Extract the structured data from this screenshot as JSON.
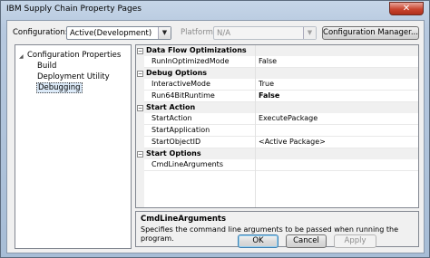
{
  "window": {
    "title": "IBM Supply Chain Property Pages",
    "close_glyph": "✕"
  },
  "toolbar": {
    "configuration_label": "Configuration:",
    "configuration_value": "Active(Development)",
    "platform_label": "Platform:",
    "platform_value": "N/A",
    "configuration_manager_label": "Configuration Manager..."
  },
  "tree": {
    "root": "Configuration Properties",
    "items": [
      {
        "label": "Build"
      },
      {
        "label": "Deployment Utility"
      },
      {
        "label": "Debugging"
      }
    ],
    "selected": "Debugging"
  },
  "grid": {
    "categories": [
      {
        "name": "Data Flow Optimizations",
        "rows": [
          {
            "name": "RunInOptimizedMode",
            "value": "False"
          }
        ]
      },
      {
        "name": "Debug Options",
        "rows": [
          {
            "name": "InteractiveMode",
            "value": "True"
          },
          {
            "name": "Run64BitRuntime",
            "value": "False"
          }
        ]
      },
      {
        "name": "Start Action",
        "rows": [
          {
            "name": "StartAction",
            "value": "ExecutePackage"
          },
          {
            "name": "StartApplication",
            "value": ""
          },
          {
            "name": "StartObjectID",
            "value": "<Active Package>"
          }
        ]
      },
      {
        "name": "Start Options",
        "rows": [
          {
            "name": "CmdLineArguments",
            "value": ""
          }
        ]
      }
    ],
    "expanded_glyph": "−"
  },
  "description": {
    "title": "CmdLineArguments",
    "text": "Specifies the command line arguments to be passed when running the program."
  },
  "buttons": {
    "ok": "OK",
    "cancel": "Cancel",
    "apply": "Apply"
  },
  "icons": {
    "dropdown": "▼",
    "tree_expander": "◢"
  }
}
